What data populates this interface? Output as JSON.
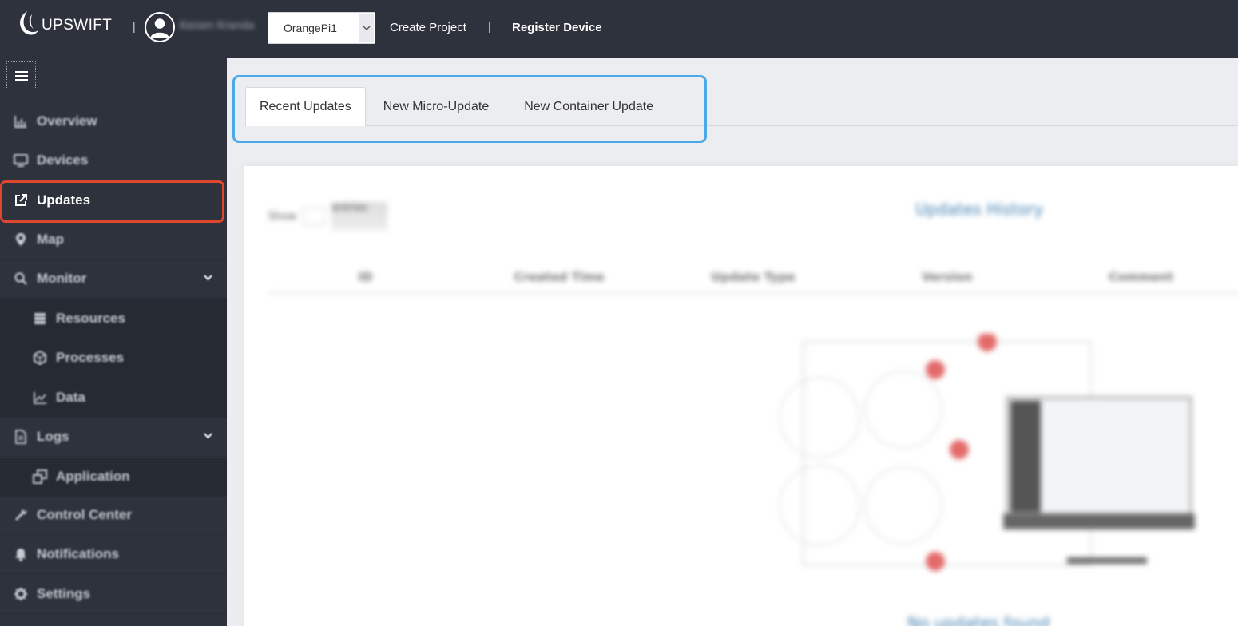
{
  "topbar": {
    "logo_text": "UPSWIFT",
    "separator": "|",
    "username": "Kaisen Kranda",
    "project": "OrangePi1",
    "create_project": "Create Project",
    "register_device": "Register Device"
  },
  "sidebar": {
    "items": [
      {
        "label": "Overview",
        "icon": "chart-icon"
      },
      {
        "label": "Devices",
        "icon": "monitor-icon"
      },
      {
        "label": "Updates",
        "icon": "external-link-icon",
        "active": true
      },
      {
        "label": "Map",
        "icon": "map-pin-icon"
      },
      {
        "label": "Monitor",
        "icon": "search-icon",
        "expandable": true
      },
      {
        "label": "Resources",
        "icon": "server-icon",
        "sub": true
      },
      {
        "label": "Processes",
        "icon": "cube-icon",
        "sub": true
      },
      {
        "label": "Data",
        "icon": "line-chart-icon",
        "sub": true
      },
      {
        "label": "Logs",
        "icon": "file-icon",
        "expandable": true
      },
      {
        "label": "Application",
        "icon": "windows-icon",
        "sub": true
      },
      {
        "label": "Control Center",
        "icon": "wrench-icon"
      },
      {
        "label": "Notifications",
        "icon": "bell-icon"
      },
      {
        "label": "Settings",
        "icon": "gear-icon"
      }
    ]
  },
  "tabs": [
    {
      "label": "Recent Updates",
      "active": true
    },
    {
      "label": "New Micro-Update"
    },
    {
      "label": "New Container Update"
    }
  ],
  "panel": {
    "show_label": "Show",
    "entries_label": "entries",
    "title": "Updates History",
    "columns": [
      "ID",
      "Created Time",
      "Update Type",
      "Version",
      "Comment"
    ],
    "empty_text": "No updates found"
  },
  "colors": {
    "bar_bg": "#2e323c",
    "main_bg": "#ebedf0",
    "active_outline": "#e0452e",
    "tabs_outline": "#4aa9e6"
  }
}
